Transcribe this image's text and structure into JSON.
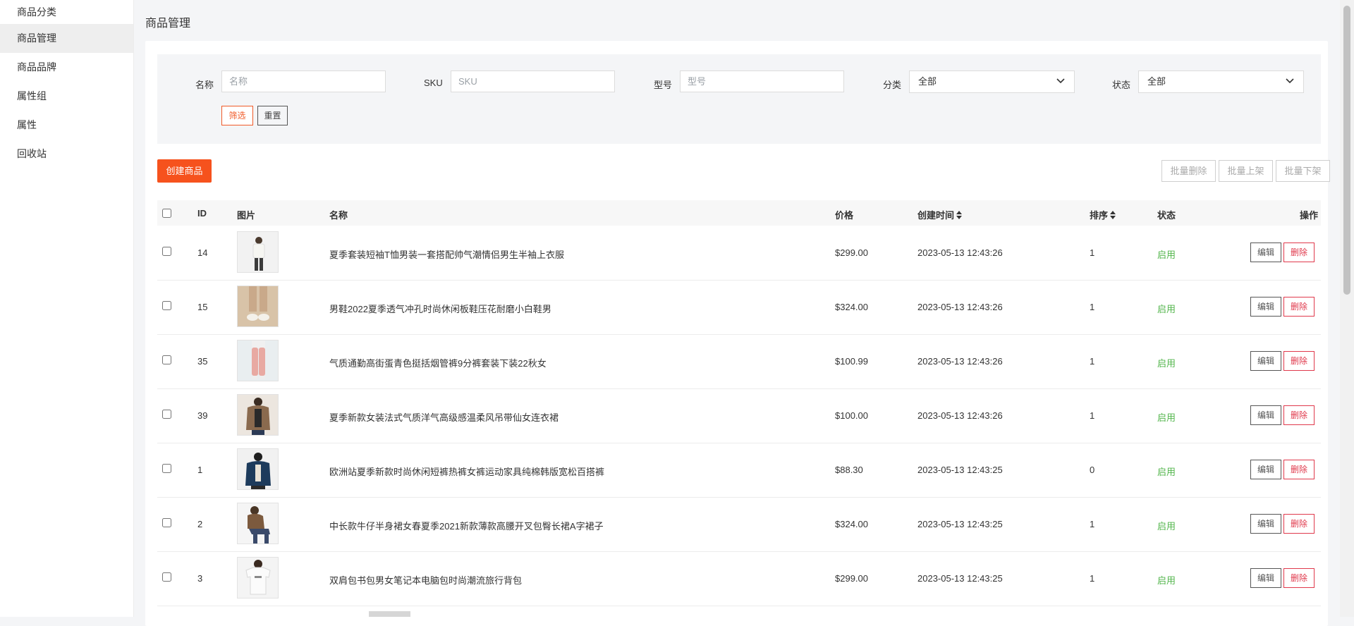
{
  "sidebar": {
    "items": [
      {
        "label": "商品分类",
        "active": false
      },
      {
        "label": "商品管理",
        "active": true
      },
      {
        "label": "商品品牌",
        "active": false
      },
      {
        "label": "属性组",
        "active": false
      },
      {
        "label": "属性",
        "active": false
      },
      {
        "label": "回收站",
        "active": false
      }
    ]
  },
  "page": {
    "title": "商品管理"
  },
  "filters": {
    "name": {
      "label": "名称",
      "placeholder": "名称",
      "value": ""
    },
    "sku": {
      "label": "SKU",
      "placeholder": "SKU",
      "value": ""
    },
    "model": {
      "label": "型号",
      "placeholder": "型号",
      "value": ""
    },
    "category": {
      "label": "分类",
      "selected": "全部"
    },
    "status": {
      "label": "状态",
      "selected": "全部"
    },
    "filter_label": "筛选",
    "reset_label": "重置"
  },
  "toolbar": {
    "create_label": "创建商品",
    "batch_delete_label": "批量删除",
    "batch_on_label": "批量上架",
    "batch_off_label": "批量下架"
  },
  "table": {
    "columns": {
      "id": "ID",
      "image": "图片",
      "name": "名称",
      "price": "价格",
      "created": "创建时间",
      "sort": "排序",
      "status": "状态",
      "actions": "操作"
    },
    "rows": [
      {
        "id": "14",
        "name": "夏季套装短袖T恤男装一套搭配帅气潮情侣男生半袖上衣服",
        "price": "$299.00",
        "created": "2023-05-13 12:43:26",
        "sort": "1",
        "status": "启用",
        "thumb": "white-tee"
      },
      {
        "id": "15",
        "name": "男鞋2022夏季透气冲孔时尚休闲板鞋压花耐磨小白鞋男",
        "price": "$324.00",
        "created": "2023-05-13 12:43:26",
        "sort": "1",
        "status": "启用",
        "thumb": "sneakers"
      },
      {
        "id": "35",
        "name": "气质通勤高街蛋青色挺括烟管裤9分裤套装下装22秋女",
        "price": "$100.99",
        "created": "2023-05-13 12:43:26",
        "sort": "1",
        "status": "启用",
        "thumb": "pink-pants"
      },
      {
        "id": "39",
        "name": "夏季新款女装法式气质洋气高级感温柔风吊带仙女连衣裙",
        "price": "$100.00",
        "created": "2023-05-13 12:43:26",
        "sort": "1",
        "status": "启用",
        "thumb": "fur-jacket"
      },
      {
        "id": "1",
        "name": "欧洲站夏季新款时尚休闲短裤热裤女裤运动家具纯棉韩版宽松百搭裤",
        "price": "$88.30",
        "created": "2023-05-13 12:43:25",
        "sort": "0",
        "status": "启用",
        "thumb": "denim-jacket"
      },
      {
        "id": "2",
        "name": "中长款牛仔半身裙女春夏季2021新款薄款高腰开叉包臀长裙A字裙子",
        "price": "$324.00",
        "created": "2023-05-13 12:43:25",
        "sort": "1",
        "status": "启用",
        "thumb": "seated-model"
      },
      {
        "id": "3",
        "name": "双肩包书包男女笔记本电脑包时尚潮流旅行背包",
        "price": "$299.00",
        "created": "2023-05-13 12:43:25",
        "sort": "1",
        "status": "启用",
        "thumb": "print-tee"
      }
    ],
    "edit_label": "编辑",
    "delete_label": "删除"
  },
  "colors": {
    "accent": "#f6521d",
    "status_on": "#52b54b",
    "danger": "#e0394c"
  }
}
